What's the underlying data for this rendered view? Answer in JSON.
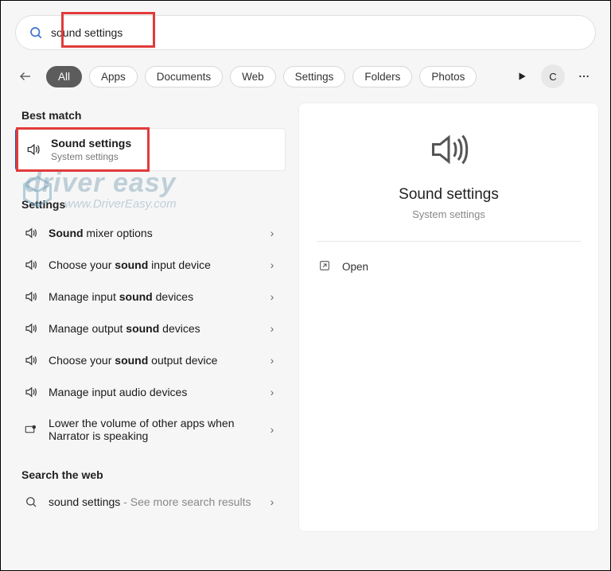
{
  "search": {
    "value": "sound settings"
  },
  "filters": {
    "items": [
      "All",
      "Apps",
      "Documents",
      "Web",
      "Settings",
      "Folders",
      "Photos"
    ],
    "active_index": 0,
    "account_letter": "C"
  },
  "sections": {
    "best_match": "Best match",
    "settings": "Settings",
    "search_web": "Search the web"
  },
  "best_match": {
    "title": "Sound settings",
    "subtitle": "System settings"
  },
  "settings_results": [
    {
      "pre": "",
      "bold": "Sound",
      "post": " mixer options"
    },
    {
      "pre": "Choose your ",
      "bold": "sound",
      "post": " input device"
    },
    {
      "pre": "Manage input ",
      "bold": "sound",
      "post": " devices"
    },
    {
      "pre": "Manage output ",
      "bold": "sound",
      "post": " devices"
    },
    {
      "pre": "Choose your ",
      "bold": "sound",
      "post": " output device"
    },
    {
      "pre": "Manage input audio devices",
      "bold": "",
      "post": ""
    },
    {
      "pre": "Lower the volume of other apps when Narrator is speaking",
      "bold": "",
      "post": "",
      "icon": "narrator"
    }
  ],
  "web_result": {
    "title": "sound settings",
    "suffix": " - See more search results"
  },
  "detail": {
    "title": "Sound settings",
    "subtitle": "System settings",
    "open_label": "Open"
  },
  "watermark": {
    "line1": "driver easy",
    "line2": "www.DriverEasy.com"
  }
}
